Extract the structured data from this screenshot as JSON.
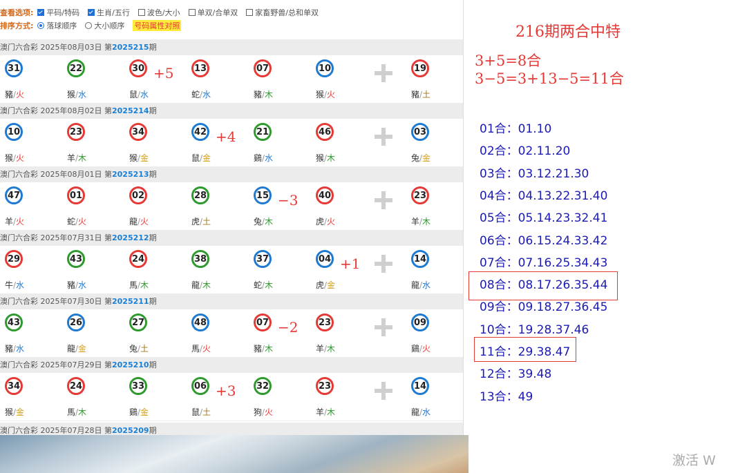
{
  "options": {
    "view_label": "查看选项:",
    "view_items": [
      {
        "label": "平码/特码",
        "checked": true
      },
      {
        "label": "生肖/五行",
        "checked": true
      },
      {
        "label": "波色/大小",
        "checked": false
      },
      {
        "label": "单双/合单双",
        "checked": false
      },
      {
        "label": "家畜野兽/总和单双",
        "checked": false
      }
    ],
    "sort_label": "排序方式:",
    "sort_items": [
      {
        "label": "落球顺序",
        "selected": true
      },
      {
        "label": "大小顺序",
        "selected": false
      }
    ],
    "attr_button": "号码属性对照"
  },
  "draws": [
    {
      "title": "澳门六合彩 2025年08月03日 第",
      "no": "2025215",
      "suffix": "期",
      "balls": [
        {
          "num": "31",
          "color": "blue",
          "zodiac": "豬",
          "el": "火",
          "elc": "fire"
        },
        {
          "num": "22",
          "color": "green",
          "zodiac": "猴",
          "el": "水",
          "elc": "water"
        },
        {
          "num": "30",
          "color": "red",
          "zodiac": "鼠",
          "el": "水",
          "elc": "water"
        },
        {
          "num": "13",
          "color": "red",
          "zodiac": "蛇",
          "el": "水",
          "elc": "water"
        },
        {
          "num": "07",
          "color": "red",
          "zodiac": "豬",
          "el": "木",
          "elc": "wood"
        },
        {
          "num": "10",
          "color": "blue",
          "zodiac": "猴",
          "el": "火",
          "elc": "fire"
        }
      ],
      "special": {
        "num": "19",
        "color": "red",
        "zodiac": "豬",
        "el": "土",
        "elc": "earth"
      },
      "annot": "+5",
      "annot_after": 2
    },
    {
      "title": "澳门六合彩 2025年08月02日 第",
      "no": "2025214",
      "suffix": "期",
      "balls": [
        {
          "num": "10",
          "color": "blue",
          "zodiac": "猴",
          "el": "火",
          "elc": "fire"
        },
        {
          "num": "23",
          "color": "red",
          "zodiac": "羊",
          "el": "木",
          "elc": "wood"
        },
        {
          "num": "34",
          "color": "red",
          "zodiac": "猴",
          "el": "金",
          "elc": "metal"
        },
        {
          "num": "42",
          "color": "blue",
          "zodiac": "鼠",
          "el": "金",
          "elc": "metal"
        },
        {
          "num": "21",
          "color": "green",
          "zodiac": "鷄",
          "el": "水",
          "elc": "water"
        },
        {
          "num": "46",
          "color": "red",
          "zodiac": "猴",
          "el": "木",
          "elc": "wood"
        }
      ],
      "special": {
        "num": "03",
        "color": "blue",
        "zodiac": "兔",
        "el": "金",
        "elc": "metal"
      },
      "annot": "+4",
      "annot_after": 3
    },
    {
      "title": "澳门六合彩 2025年08月01日 第",
      "no": "2025213",
      "suffix": "期",
      "balls": [
        {
          "num": "47",
          "color": "blue",
          "zodiac": "羊",
          "el": "火",
          "elc": "fire"
        },
        {
          "num": "01",
          "color": "red",
          "zodiac": "蛇",
          "el": "火",
          "elc": "fire"
        },
        {
          "num": "02",
          "color": "red",
          "zodiac": "龍",
          "el": "火",
          "elc": "fire"
        },
        {
          "num": "28",
          "color": "green",
          "zodiac": "虎",
          "el": "土",
          "elc": "earth"
        },
        {
          "num": "15",
          "color": "blue",
          "zodiac": "兔",
          "el": "木",
          "elc": "wood"
        },
        {
          "num": "40",
          "color": "red",
          "zodiac": "虎",
          "el": "火",
          "elc": "fire"
        }
      ],
      "special": {
        "num": "23",
        "color": "red",
        "zodiac": "羊",
        "el": "木",
        "elc": "wood"
      },
      "annot": "−3",
      "annot_after": 4
    },
    {
      "title": "澳门六合彩 2025年07月31日 第",
      "no": "2025212",
      "suffix": "期",
      "balls": [
        {
          "num": "29",
          "color": "red",
          "zodiac": "牛",
          "el": "水",
          "elc": "water"
        },
        {
          "num": "43",
          "color": "green",
          "zodiac": "豬",
          "el": "水",
          "elc": "water"
        },
        {
          "num": "24",
          "color": "red",
          "zodiac": "馬",
          "el": "木",
          "elc": "wood"
        },
        {
          "num": "38",
          "color": "green",
          "zodiac": "龍",
          "el": "木",
          "elc": "wood"
        },
        {
          "num": "37",
          "color": "blue",
          "zodiac": "蛇",
          "el": "木",
          "elc": "wood"
        },
        {
          "num": "04",
          "color": "blue",
          "zodiac": "虎",
          "el": "金",
          "elc": "metal"
        }
      ],
      "special": {
        "num": "14",
        "color": "blue",
        "zodiac": "龍",
        "el": "水",
        "elc": "water"
      },
      "annot": "+1",
      "annot_after": 5
    },
    {
      "title": "澳门六合彩 2025年07月30日 第",
      "no": "2025211",
      "suffix": "期",
      "balls": [
        {
          "num": "43",
          "color": "green",
          "zodiac": "豬",
          "el": "水",
          "elc": "water"
        },
        {
          "num": "26",
          "color": "blue",
          "zodiac": "龍",
          "el": "金",
          "elc": "metal"
        },
        {
          "num": "27",
          "color": "green",
          "zodiac": "兔",
          "el": "土",
          "elc": "earth"
        },
        {
          "num": "48",
          "color": "blue",
          "zodiac": "馬",
          "el": "火",
          "elc": "fire"
        },
        {
          "num": "07",
          "color": "red",
          "zodiac": "豬",
          "el": "木",
          "elc": "wood"
        },
        {
          "num": "23",
          "color": "red",
          "zodiac": "羊",
          "el": "木",
          "elc": "wood"
        }
      ],
      "special": {
        "num": "09",
        "color": "blue",
        "zodiac": "鷄",
        "el": "火",
        "elc": "fire"
      },
      "annot": "−2",
      "annot_after": 4
    },
    {
      "title": "澳门六合彩 2025年07月29日 第",
      "no": "2025210",
      "suffix": "期",
      "balls": [
        {
          "num": "34",
          "color": "red",
          "zodiac": "猴",
          "el": "金",
          "elc": "metal"
        },
        {
          "num": "24",
          "color": "red",
          "zodiac": "馬",
          "el": "木",
          "elc": "wood"
        },
        {
          "num": "33",
          "color": "green",
          "zodiac": "鷄",
          "el": "金",
          "elc": "metal"
        },
        {
          "num": "06",
          "color": "green",
          "zodiac": "鼠",
          "el": "土",
          "elc": "earth"
        },
        {
          "num": "32",
          "color": "green",
          "zodiac": "狗",
          "el": "火",
          "elc": "fire"
        },
        {
          "num": "23",
          "color": "red",
          "zodiac": "羊",
          "el": "木",
          "elc": "wood"
        }
      ],
      "special": {
        "num": "14",
        "color": "blue",
        "zodiac": "龍",
        "el": "水",
        "elc": "water"
      },
      "annot": "+3",
      "annot_after": 3
    }
  ],
  "last_head": {
    "title": "澳门六合彩 2025年07月28日 第",
    "no": "2025209",
    "suffix": "期"
  },
  "right": {
    "title": "216期两合中特",
    "formula1": "3+5=8合",
    "formula2": "3−5=3+13−5=11合",
    "he_list": [
      "01合：01.10",
      "02合：02.11.20",
      "03合：03.12.21.30",
      "04合：04.13.22.31.40",
      "05合：05.14.23.32.41",
      "06合：06.15.24.33.42",
      "07合：07.16.25.34.43",
      "08合：08.17.26.35.44",
      "09合：09.18.27.36.45",
      "10合：19.28.37.46",
      "11合：29.38.47",
      "12合：39.48",
      "13合：49"
    ],
    "highlight_color": "#e53935",
    "text_color": "#1a1ab5"
  },
  "activate_text": "激活 W"
}
